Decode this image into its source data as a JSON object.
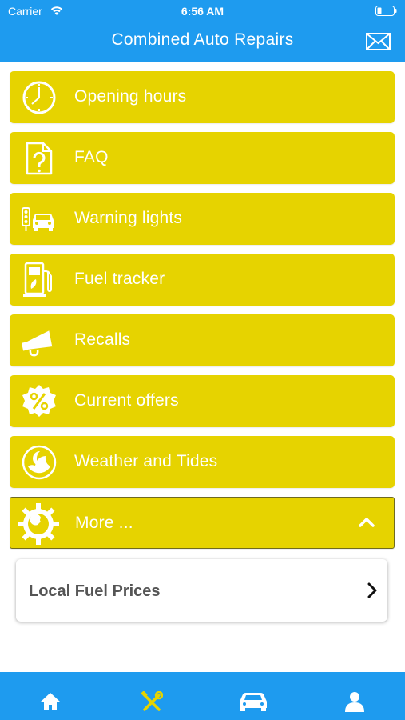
{
  "status_bar": {
    "carrier": "Carrier",
    "time": "6:56 AM"
  },
  "header": {
    "title": "Combined Auto Repairs",
    "mail_icon": "envelope-icon"
  },
  "menu": [
    {
      "label": "Opening hours",
      "icon": "clock-icon"
    },
    {
      "label": "FAQ",
      "icon": "faq-document-icon"
    },
    {
      "label": "Warning lights",
      "icon": "traffic-light-car-icon"
    },
    {
      "label": "Fuel tracker",
      "icon": "fuel-pump-icon"
    },
    {
      "label": "Recalls",
      "icon": "megaphone-icon"
    },
    {
      "label": "Current offers",
      "icon": "percent-badge-icon"
    },
    {
      "label": "Weather and Tides",
      "icon": "weather-icon"
    },
    {
      "label": "More ...",
      "icon": "wrench-gear-icon"
    }
  ],
  "submenu": {
    "label": "Local Fuel Prices"
  },
  "tabs": [
    {
      "name": "home",
      "icon": "home-icon"
    },
    {
      "name": "services",
      "icon": "tools-icon",
      "active": true
    },
    {
      "name": "vehicle",
      "icon": "car-icon"
    },
    {
      "name": "profile",
      "icon": "user-icon"
    }
  ],
  "colors": {
    "primary_blue": "#1e9bef",
    "menu_yellow": "#e6d300",
    "active_tab": "#e6d300",
    "submenu_text": "#555555"
  }
}
